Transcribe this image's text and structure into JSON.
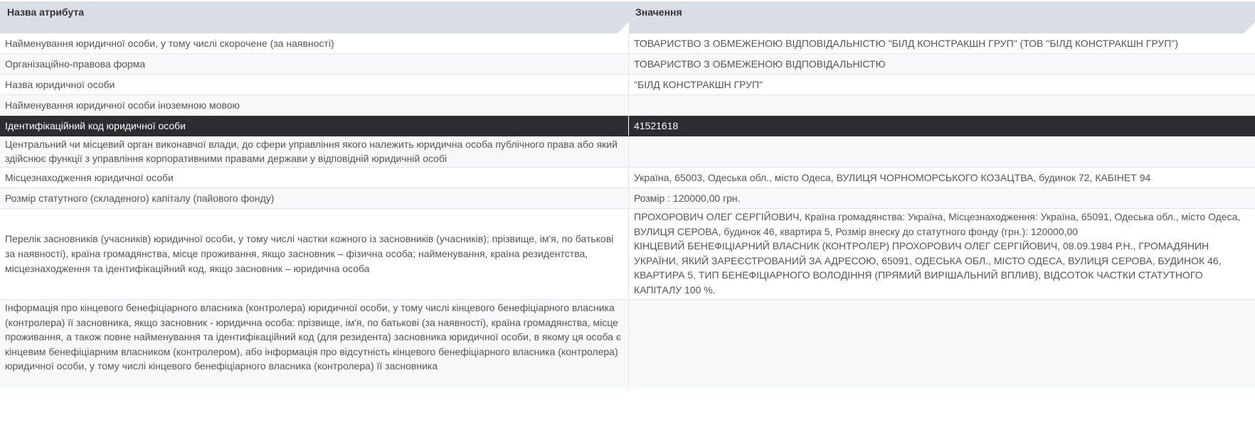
{
  "header": {
    "attr_name": "Назва атрибута",
    "value": "Значення"
  },
  "rows": [
    {
      "label": "Найменування юридичної особи, у тому числі скорочене (за наявності)",
      "value": "ТОВАРИСТВО З ОБМЕЖЕНОЮ ВІДПОВІДАЛЬНІСТЮ \"БІЛД КОНСТРАКШН ГРУП\" (ТОВ \"БІЛД КОНСТРАКШН ГРУП\")"
    },
    {
      "label": "Організаційно-правова форма",
      "value": "ТОВАРИСТВО З ОБМЕЖЕНОЮ ВІДПОВІДАЛЬНІСТЮ"
    },
    {
      "label": "Назва юридичної особи",
      "value": "\"БІЛД КОНСТРАКШН ГРУП\""
    },
    {
      "label": "Найменування юридичної особи іноземною мовою",
      "value": ""
    },
    {
      "label": "Ідентифікаційний код юридичної особи",
      "value": "41521618"
    },
    {
      "label": "Центральний чи місцевий орган виконавчої влади, до сфери управління якого належить юридична особа публічного права або який здійснює функції з управління корпоративними правами держави у відповідній юридичній особі",
      "value": ""
    },
    {
      "label": "Місцезнаходження юридичної особи",
      "value": "Україна, 65003, Одеська обл., місто Одеса, ВУЛИЦЯ ЧОРНОМОРСЬКОГО КОЗАЦТВА, будинок 72, КАБІНЕТ 94"
    },
    {
      "label": "Розмір статутного (складеного) капіталу (пайового фонду)",
      "value": "Розмір : 120000,00 грн."
    },
    {
      "label": "Перелік засновників (учасників) юридичної особи, у тому числі частки кожного із засновників (учасників); прізвище, ім'я, по батькові за наявності), країна громадянства, місце проживання, якщо засновник – фізична особа; найменування, країна резидентства, місцезнаходження та ідентифікаційний код, якщо засновник – юридична особа",
      "value_line1": "ПРОХОРОВИЧ ОЛЕГ СЕРГІЙОВИЧ, Країна громадянства: Україна, Місцезнаходження: Україна, 65091, Одеська обл., місто Одеса, ВУЛИЦЯ СЕРОВА, будинок 46, квартира 5, Розмір внеску до статутного фонду (грн.): 120000,00",
      "value_line2": "КІНЦЕВИЙ БЕНЕФІЦІАРНИЙ ВЛАСНИК (КОНТРОЛЕР) ПРОХОРОВИЧ ОЛЕГ СЕРГІЙОВИЧ, 08.09.1984 Р.Н., ГРОМАДЯНИН УКРАЇНИ, ЯКИЙ ЗАРЕЄСТРОВАНИЙ ЗА АДРЕСОЮ, 65091, ОДЕСЬКА ОБЛ., МІСТО ОДЕСА, ВУЛИЦЯ СЕРОВА, БУДИНОК 46, КВАРТИРА 5, ТИП БЕНЕФІЦІАРНОГО ВОЛОДІННЯ (ПРЯМИЙ ВИРІШАЛЬНИЙ ВПЛИВ), ВІДСОТОК ЧАСТКИ СТАТУТНОГО КАПІТАЛУ 100 %."
    },
    {
      "label": "Інформація про кінцевого бенефіціарного власника (контролера) юридичної особи, у тому числі кінцевого бенефіціарного власника (контролера) її засновника, якщо засновник - юридична особа: прізвище, ім'я, по батькові (за наявності), країна громадянства, місце проживання, а також повне найменування та ідентифікаційний код (для резидента) засновника юридичної особи, в якому ця особа є кінцевим бенефіціарним власником (контролером), або інформація про відсутність кінцевого бенефіціарного власника (контролера) юридичної особи, у тому числі кінцевого бенефіціарного власника (контролера) її засновника",
      "value": ""
    }
  ]
}
